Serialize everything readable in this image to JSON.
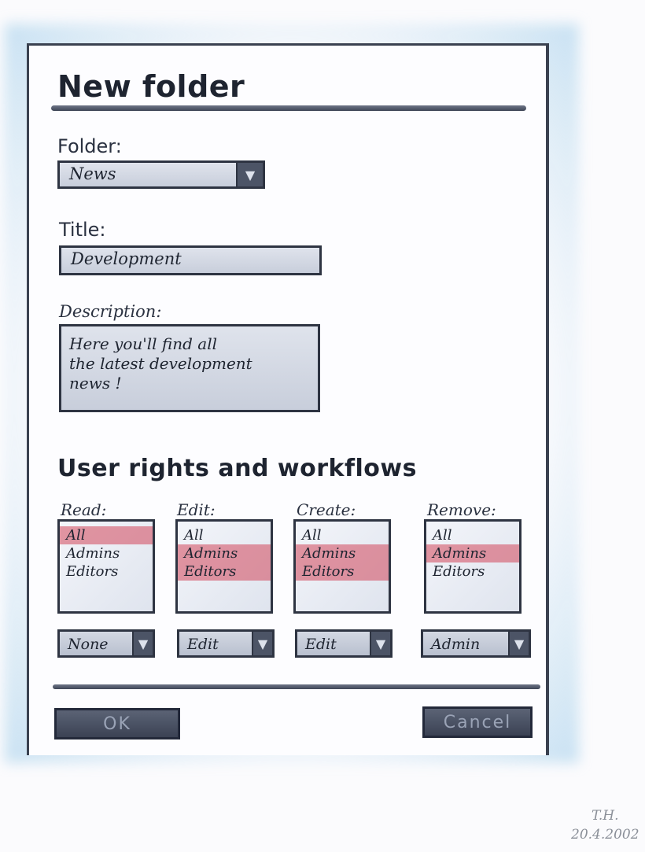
{
  "dialog": {
    "title": "New folder"
  },
  "folder": {
    "label": "Folder:",
    "value": "News"
  },
  "title_field": {
    "label": "Title:",
    "value": "Development"
  },
  "description": {
    "label": "Description:",
    "value": "Here you'll find all\nthe latest development\nnews !"
  },
  "rights": {
    "heading": "User rights and workflows",
    "columns": [
      {
        "label": "Read:",
        "items": [
          "All",
          "Admins",
          "Editors"
        ],
        "selected": [
          "All"
        ],
        "workflow": "None"
      },
      {
        "label": "Edit:",
        "items": [
          "All",
          "Admins",
          "Editors"
        ],
        "selected": [
          "Admins",
          "Editors"
        ],
        "workflow": "Edit"
      },
      {
        "label": "Create:",
        "items": [
          "All",
          "Admins",
          "Editors"
        ],
        "selected": [
          "Admins",
          "Editors"
        ],
        "workflow": "Edit"
      },
      {
        "label": "Remove:",
        "items": [
          "All",
          "Admins",
          "Editors"
        ],
        "selected": [
          "Admins"
        ],
        "workflow": "Admin"
      }
    ]
  },
  "buttons": {
    "ok": "OK",
    "cancel": "Cancel"
  },
  "signature": {
    "initials": "T.H.",
    "date": "20.4.2002"
  },
  "colors": {
    "selection": "#d2465a",
    "border": "#2e3442",
    "glow": "#8cc3e6"
  },
  "icons": {
    "dropdown": "triangle-down-icon"
  }
}
